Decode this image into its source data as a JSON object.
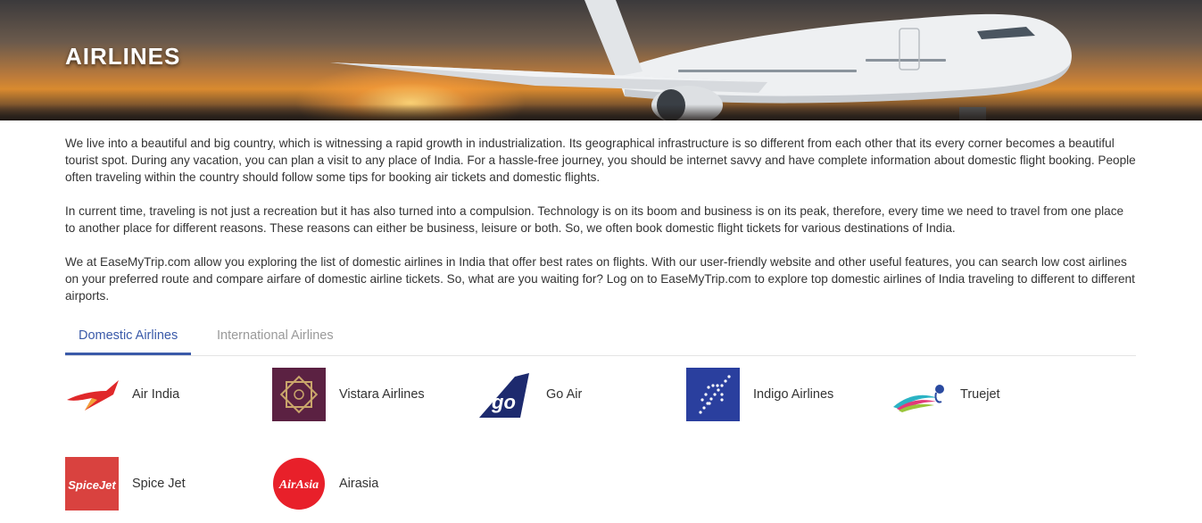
{
  "hero": {
    "title": "AIRLINES"
  },
  "intro": {
    "paragraphs": [
      "We live into a beautiful and big country, which is witnessing a rapid growth in industrialization. Its geographical infrastructure is so different from each other that its every corner becomes a beautiful tourist spot. During any vacation, you can plan a visit to any place of India. For a hassle-free journey, you should be internet savvy and have complete information about domestic flight booking. People often traveling within the country should follow some tips for booking air tickets and domestic flights.",
      "In current time, traveling is not just a recreation but it has also turned into a compulsion. Technology is on its boom and business is on its peak, therefore, every time we need to travel from one place to another place for different reasons. These reasons can either be business, leisure or both. So, we often book domestic flight tickets for various destinations of India.",
      "We at EaseMyTrip.com allow you exploring the list of domestic airlines in India that offer best rates on flights. With our user-friendly website and other useful features, you can search low cost airlines on your preferred route and compare airfare of domestic airline tickets. So, what are you waiting for? Log on to EaseMyTrip.com to explore top domestic airlines of India traveling to different to different airports."
    ]
  },
  "tabs": [
    {
      "label": "Domestic Airlines",
      "active": true
    },
    {
      "label": "International Airlines",
      "active": false
    }
  ],
  "airlines": [
    {
      "name": "Air India",
      "icon": "air-india-logo-icon"
    },
    {
      "name": "Vistara Airlines",
      "icon": "vistara-logo-icon"
    },
    {
      "name": "Go Air",
      "icon": "go-air-logo-icon"
    },
    {
      "name": "Indigo Airlines",
      "icon": "indigo-logo-icon"
    },
    {
      "name": "Truejet",
      "icon": "truejet-logo-icon"
    },
    {
      "name": "Spice Jet",
      "icon": "spicejet-logo-icon",
      "logo_text": "SpiceJet"
    },
    {
      "name": "Airasia",
      "icon": "airasia-logo-icon",
      "logo_text": "AirAsia"
    }
  ],
  "colors": {
    "accent": "#3a5aa9",
    "vistara": "#5b2142",
    "indigo": "#2a3f9e",
    "goair": "#1d2a6e",
    "spicejet": "#d9423f",
    "airasia": "#e8202a",
    "airindia": "#e0282a"
  }
}
